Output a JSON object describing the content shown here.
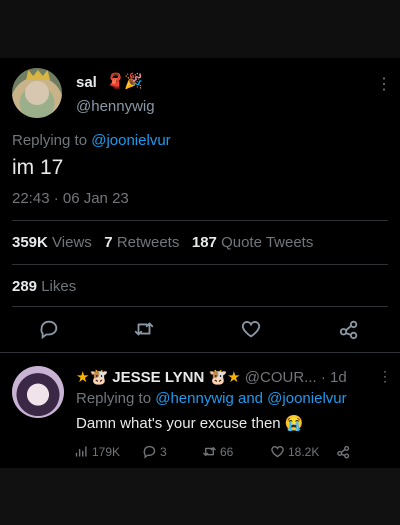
{
  "tweet": {
    "display_name": "sal",
    "emojis": [
      "🧣",
      "🎉"
    ],
    "handle": "@hennywig",
    "replying_prefix": "Replying to",
    "replying_to": "@joonielvur",
    "text": "im 17",
    "timestamp": "22:43 · 06 Jan 23",
    "views_count": "359K",
    "views_label": "Views",
    "retweets_count": "7",
    "retweets_label": "Retweets",
    "quotes_count": "187",
    "quotes_label": "Quote Tweets",
    "likes_count": "289",
    "likes_label": "Likes",
    "more_symbol": "⋮"
  },
  "reply": {
    "prefix_emoji": "★🐮",
    "display_name": "JESSE LYNN",
    "suffix_emoji": "🐮★",
    "handle": "@COUR...",
    "age": "· 1d",
    "replying_prefix": "Replying to",
    "replying_to": "@hennywig and @joonielvur",
    "text": "Damn what's your excuse then 😭",
    "views": "179K",
    "replies": "3",
    "retweets": "66",
    "likes": "18.2K",
    "more_symbol": "⋮"
  },
  "icons": [
    "reply-icon",
    "retweet-icon",
    "like-icon",
    "share-icon",
    "views-icon"
  ],
  "colors": {
    "link": "#1d9bf0",
    "muted": "#71767b",
    "text": "#e7e9ea",
    "star": "#f4b400"
  }
}
